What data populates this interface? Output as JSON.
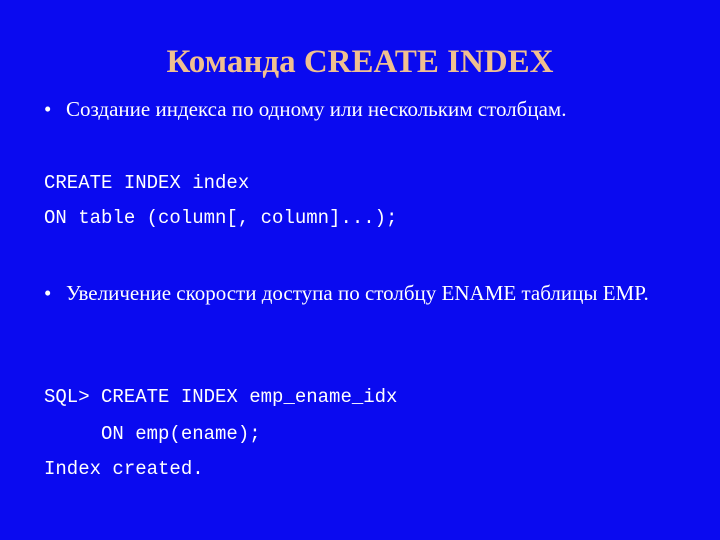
{
  "slide": {
    "title": "Команда CREATE INDEX",
    "bullets": [
      {
        "marker": "•",
        "text": "Создание индекса по одному или нескольким столбцам."
      },
      {
        "marker": "•",
        "text": "Увеличение скорости доступа по столбцу ENAME таблицы EMP."
      }
    ],
    "syntax_lines": [
      "CREATE INDEX index",
      "ON table (column[, column]...);"
    ],
    "example_lines": [
      "SQL> CREATE INDEX emp_ename_idx",
      "     ON emp(ename);",
      "Index created."
    ],
    "colors": {
      "background": "#0a0af0",
      "title": "#f0c090",
      "text": "#ffffff"
    }
  }
}
